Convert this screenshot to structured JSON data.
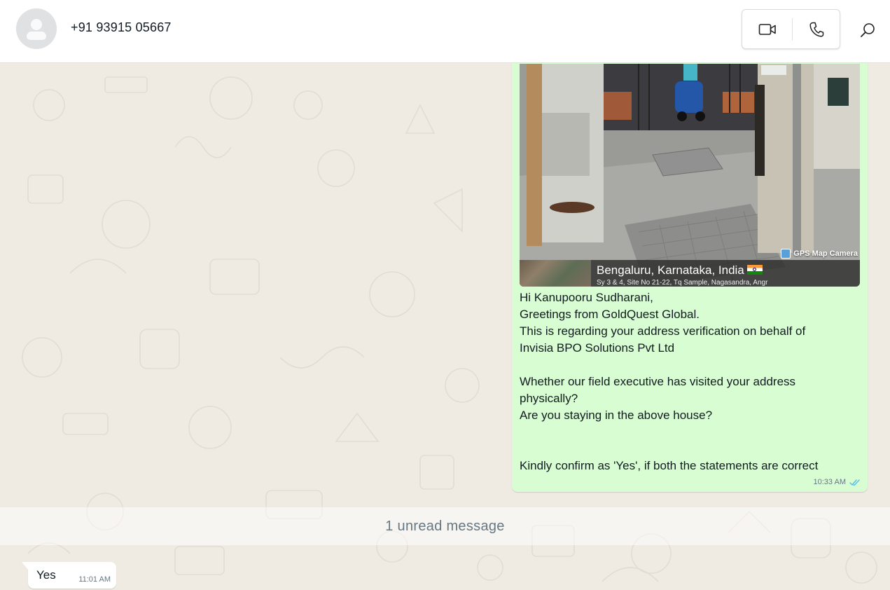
{
  "header": {
    "contact_name": "+91 93915 05667",
    "avatar_icon": "default-user-avatar",
    "video_call_icon": "video-camera-icon",
    "voice_call_icon": "phone-icon",
    "search_icon": "search-icon"
  },
  "messages": {
    "outgoing": {
      "image": {
        "overlay_badge": "GPS Map Camera",
        "location_title": "Bengaluru, Karnataka, India",
        "location_subtitle": "Sy 3 & 4, Site No 21-22, Tq Sample, Nagasandra, Angr"
      },
      "lines": [
        "Hi Kanupooru Sudharani,",
        "Greetings from GoldQuest Global.",
        "This is regarding your address verification on behalf of",
        "Invisia BPO Solutions Pvt Ltd",
        "",
        "Whether our field executive has visited your address",
        "physically?",
        "Are you staying in the above house?",
        "",
        "",
        "Kindly confirm as 'Yes', if both the statements are correct"
      ],
      "time": "10:33 AM",
      "status": "read-double-tick",
      "tick_color": "#53bdeb"
    },
    "unread_divider": "1 unread message",
    "incoming": {
      "text": "Yes",
      "time": "11:01 AM"
    }
  },
  "colors": {
    "outgoing_bubble": "#d9fdd3",
    "incoming_bubble": "#ffffff",
    "chat_background": "#efeae2"
  }
}
